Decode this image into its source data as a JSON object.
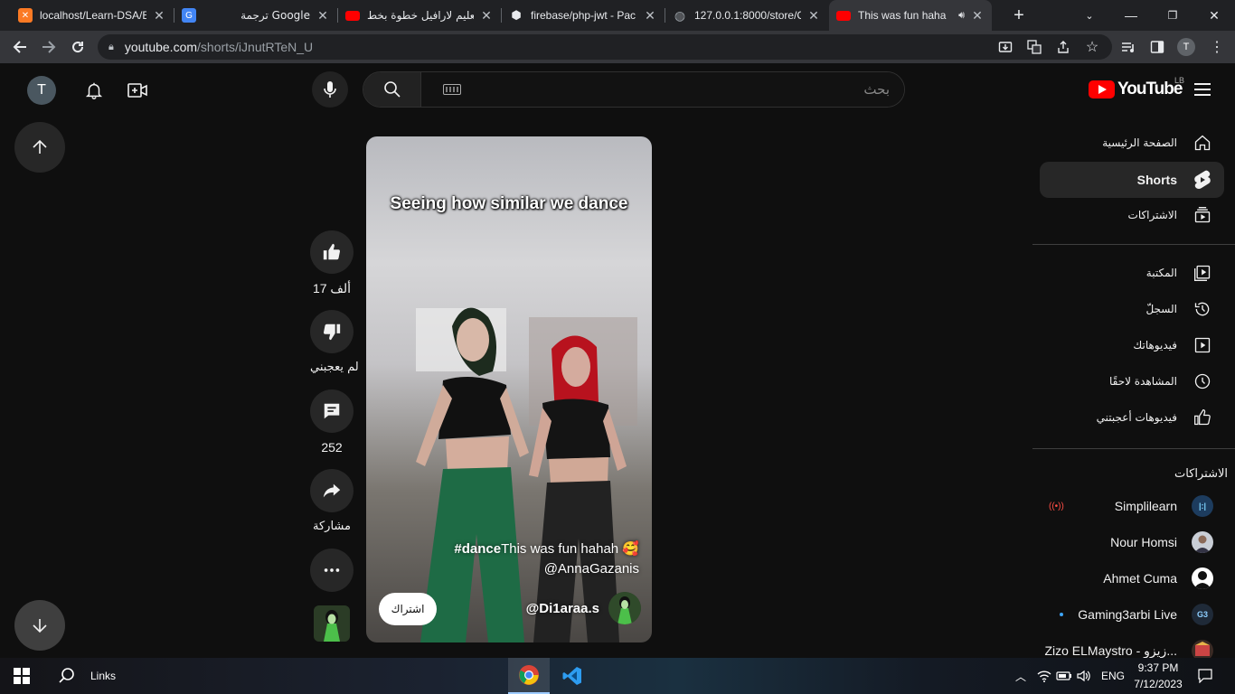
{
  "browser": {
    "tabs": [
      {
        "title": "localhost/Learn-DSA/E",
        "favicon": "xampp-icon",
        "color": "#fb7a24"
      },
      {
        "title": "ترجمة Google",
        "favicon": "google-translate-icon",
        "color": "#4285f4"
      },
      {
        "title": "تعليم لارافيل خطوة بخط",
        "favicon": "youtube-icon",
        "color": "#ff0000"
      },
      {
        "title": "firebase/php-jwt - Pac",
        "favicon": "packagist-icon",
        "color": "#e8eaed"
      },
      {
        "title": "127.0.0.1:8000/store/C",
        "favicon": "globe-icon",
        "color": "#9aa0a6"
      },
      {
        "title": "This was fun haha",
        "favicon": "youtube-icon",
        "color": "#ff0000"
      }
    ],
    "url_host": "youtube.com",
    "url_path": "/shorts/iJnutRTeN_U",
    "profile_initial": "T"
  },
  "header": {
    "avatar_initial": "T",
    "search_placeholder": "بحث",
    "logo_text": "YouTube",
    "country_code": "LB"
  },
  "short": {
    "overlay_text": "Seeing how similar we dance",
    "hashtag": "#dance",
    "description": "This was fun hahah 🥰",
    "mention": "@AnnaGazanis",
    "channel_handle": "@Di1araa.s",
    "subscribe_label": "اشتراك"
  },
  "actions": {
    "like_count": "17 ألف",
    "dislike_label": "لم يعجبني",
    "comment_count": "252",
    "share_label": "مشاركة"
  },
  "sidebar": {
    "items": [
      {
        "label": "الصفحة الرئيسية",
        "icon": "home-icon"
      },
      {
        "label": "Shorts",
        "icon": "shorts-icon"
      },
      {
        "label": "الاشتراكات",
        "icon": "subscriptions-icon"
      },
      {
        "label": "المكتبة",
        "icon": "library-icon"
      },
      {
        "label": "السجلّ",
        "icon": "history-icon"
      },
      {
        "label": "فيديوهاتك",
        "icon": "your-videos-icon"
      },
      {
        "label": "المشاهدة لاحقًا",
        "icon": "watch-later-icon"
      },
      {
        "label": "فيديوهات أعجبتني",
        "icon": "liked-videos-icon"
      }
    ],
    "subscriptions_heading": "الاشتراكات",
    "subscriptions": [
      {
        "name": "Simplilearn",
        "avatar_color": "#1d3c5e",
        "avatar_text": "|:|",
        "live": true
      },
      {
        "name": "Nour Homsi",
        "avatar_color": "#c9ced6",
        "avatar_text": ""
      },
      {
        "name": "Ahmet Cuma",
        "avatar_color": "#ffffff",
        "avatar_text": ""
      },
      {
        "name": "Gaming3arbi Live",
        "avatar_color": "#1f2a38",
        "avatar_text": "G3",
        "new": true
      },
      {
        "name": "Zizo ELMaystro - زيزو...",
        "avatar_color": "#3b2a24",
        "avatar_text": ""
      }
    ]
  },
  "taskbar": {
    "links_label": "Links",
    "lang": "ENG",
    "time": "9:37 PM",
    "date": "7/12/2023"
  },
  "colors": {
    "background": "#0f0f0f",
    "accent_red": "#ff0000",
    "active_nav": "#272727"
  }
}
